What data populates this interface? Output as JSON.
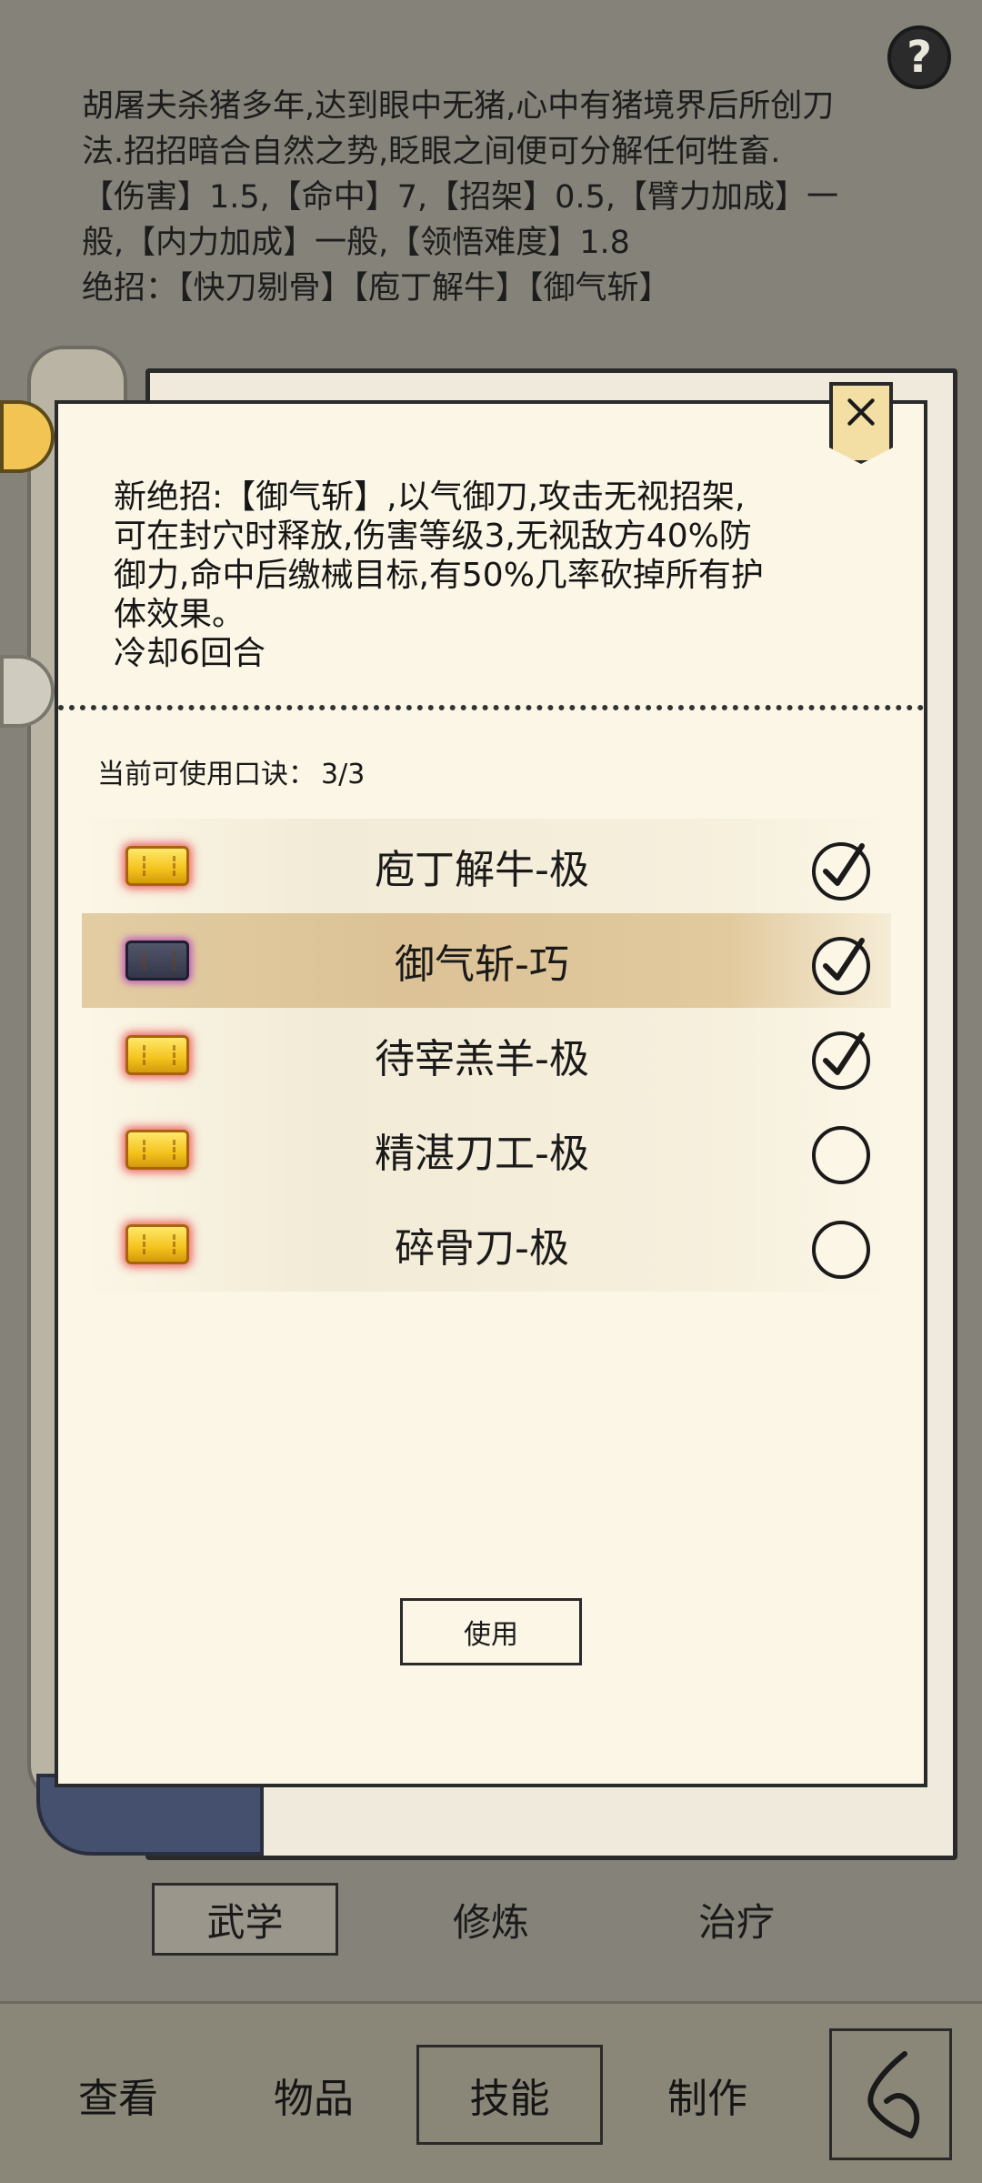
{
  "skill_description": {
    "lines": [
      "胡屠夫杀猪多年,达到眼中无猪,心中有猪境界后所创刀",
      "法.招招暗合自然之势,眨眼之间便可分解任何牲畜.",
      "【伤害】1.5,【命中】7,【招架】0.5,【臂力加成】一",
      "般,【内力加成】一般,【领悟难度】1.8",
      "绝招：【快刀剔骨】【庖丁解牛】【御气斩】"
    ]
  },
  "panel": {
    "ultimate_lines": [
      "新绝招:【御气斩】,以气御刀,攻击无视招架,",
      "可在封穴时释放,伤害等级3,无视敌方40%防",
      "御力,命中后缴械目标,有50%几率砍掉所有护",
      "体效果。",
      "冷却6回合"
    ],
    "koujue_label": "当前可使用口诀：",
    "koujue_count": "3/3",
    "use_button": "使用"
  },
  "skills": [
    {
      "name": "庖丁解牛-极",
      "book": "gold",
      "checked": true
    },
    {
      "name": "御气斩-巧",
      "book": "dark",
      "checked": true
    },
    {
      "name": "待宰羔羊-极",
      "book": "gold",
      "checked": true
    },
    {
      "name": "精湛刀工-极",
      "book": "gold",
      "checked": false
    },
    {
      "name": "碎骨刀-极",
      "book": "gold",
      "checked": false
    }
  ],
  "tabs": {
    "wuxue": "武学",
    "xiulian": "修炼",
    "zhiliao": "治疗"
  },
  "nav": {
    "chakan": "查看",
    "wupin": "物品",
    "jineng": "技能",
    "zhizuo": "制作"
  },
  "icons": {
    "help": "help-icon",
    "close": "close-icon",
    "back": "back-arrow-icon"
  },
  "colors": {
    "panel_bg": "#fbf6e6",
    "page_bg": "#858279",
    "selected_row": "#dcc296"
  }
}
